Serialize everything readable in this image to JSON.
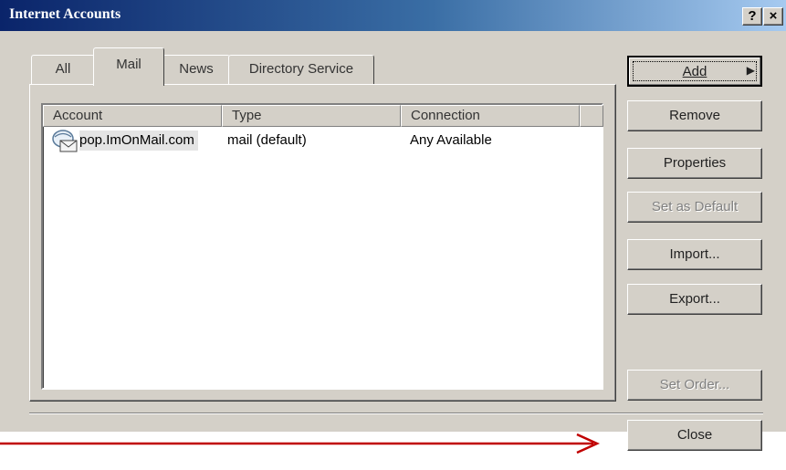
{
  "window": {
    "title": "Internet Accounts",
    "help_label": "?",
    "close_label": "×"
  },
  "tabs": [
    {
      "label": "All"
    },
    {
      "label": "Mail",
      "selected": true
    },
    {
      "label": "News"
    },
    {
      "label": "Directory Service"
    }
  ],
  "table": {
    "columns": [
      "Account",
      "Type",
      "Connection"
    ],
    "rows": [
      {
        "icon": "mail-server-icon",
        "account": "pop.ImOnMail.com",
        "type": "mail (default)",
        "connection": "Any Available"
      }
    ]
  },
  "buttons": {
    "add": "Add",
    "remove": "Remove",
    "properties": "Properties",
    "set_default": "Set as Default",
    "import": "Import...",
    "export": "Export...",
    "set_order": "Set Order...",
    "close": "Close"
  },
  "colors": {
    "dialog_bg": "#d4d0c8",
    "title_gradient_start": "#0a246a",
    "title_gradient_end": "#a6caf0",
    "annotation_arrow": "#c00000"
  }
}
